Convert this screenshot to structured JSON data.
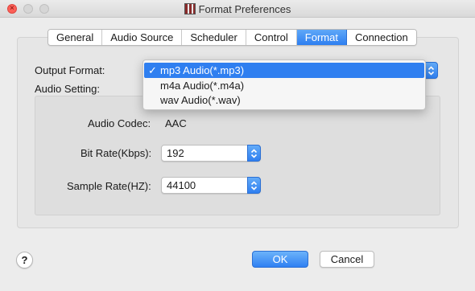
{
  "window": {
    "title": "Format Preferences"
  },
  "tabs": [
    {
      "label": "General"
    },
    {
      "label": "Audio Source"
    },
    {
      "label": "Scheduler"
    },
    {
      "label": "Control"
    },
    {
      "label": "Format"
    },
    {
      "label": "Connection"
    }
  ],
  "active_tab": "Format",
  "output_format": {
    "label": "Output Format:",
    "options": [
      {
        "label": "mp3 Audio(*.mp3)",
        "selected": true
      },
      {
        "label": "m4a Audio(*.m4a)",
        "selected": false
      },
      {
        "label": "wav Audio(*.wav)",
        "selected": false
      }
    ],
    "check_mark": "✓"
  },
  "audio_setting": {
    "label": "Audio Setting:",
    "codec_label": "Audio Codec:",
    "codec_value": "AAC",
    "bitrate_label": "Bit Rate(Kbps):",
    "bitrate_value": "192",
    "samplerate_label": "Sample Rate(HZ):",
    "samplerate_value": "44100"
  },
  "buttons": {
    "help": "?",
    "ok": "OK",
    "cancel": "Cancel"
  },
  "colors": {
    "accent": "#2f7ff0",
    "close": "#fc5f57"
  }
}
